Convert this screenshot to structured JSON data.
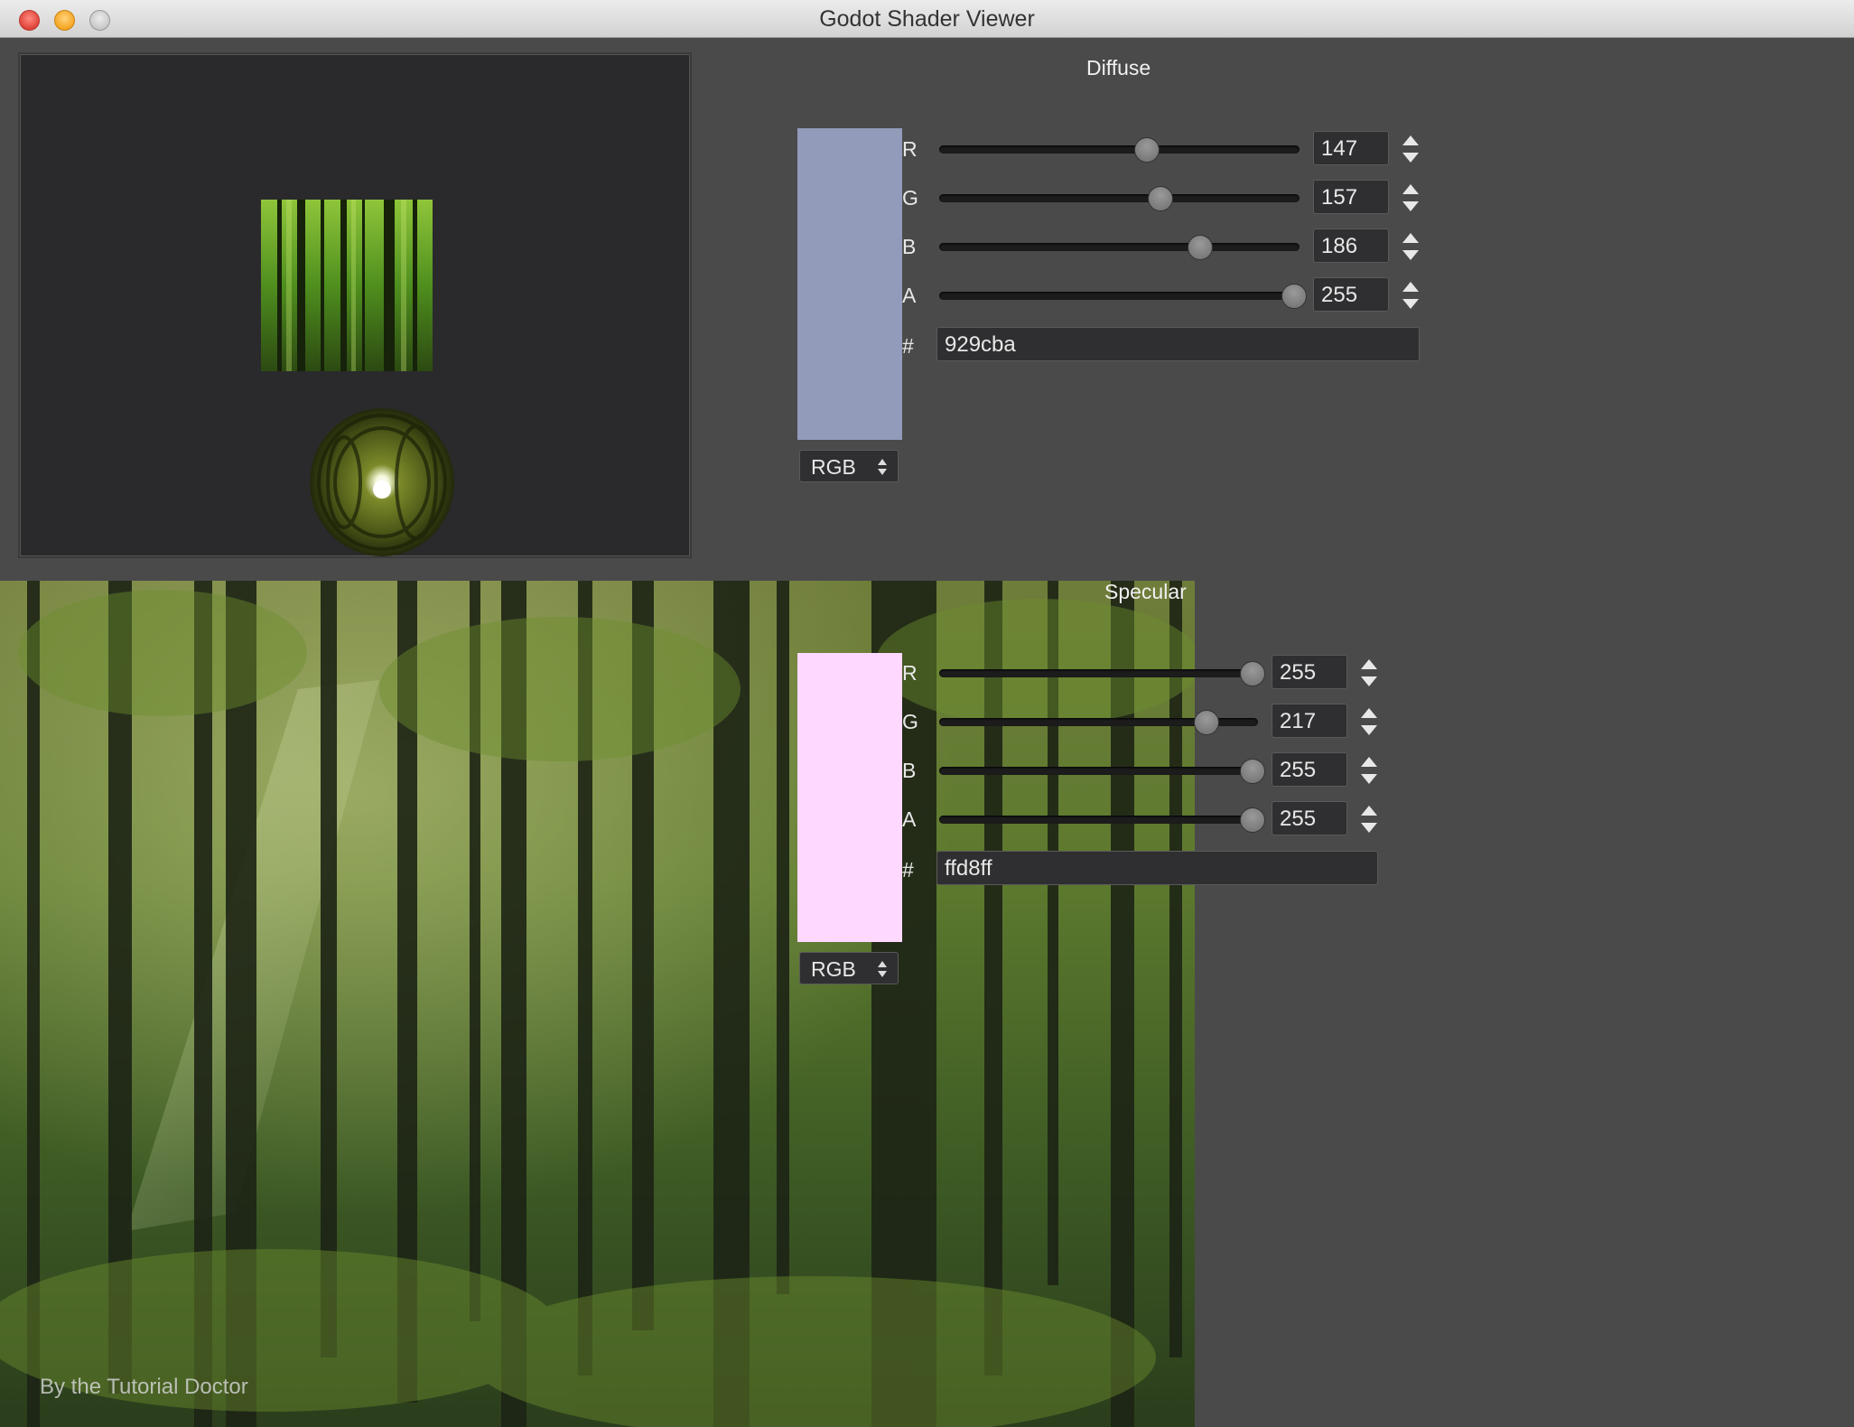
{
  "window": {
    "title": "Godot Shader Viewer"
  },
  "credit": "By the Tutorial Doctor",
  "diffuse": {
    "title": "Diffuse",
    "color": "#929cba",
    "mode": "RGB",
    "hex_label": "#",
    "hex": "929cba",
    "channels": [
      {
        "label": "R",
        "value": "147",
        "fraction": 0.576
      },
      {
        "label": "G",
        "value": "157",
        "fraction": 0.616
      },
      {
        "label": "B",
        "value": "186",
        "fraction": 0.729
      },
      {
        "label": "A",
        "value": "255",
        "fraction": 1.0
      }
    ]
  },
  "specular": {
    "title": "Specular",
    "color": "#ffd8ff",
    "mode": "RGB",
    "hex_label": "#",
    "hex": "ffd8ff",
    "channels": [
      {
        "label": "R",
        "value": "255",
        "fraction": 1.0
      },
      {
        "label": "G",
        "value": "217",
        "fraction": 0.851
      },
      {
        "label": "B",
        "value": "255",
        "fraction": 1.0
      },
      {
        "label": "A",
        "value": "255",
        "fraction": 1.0
      }
    ]
  }
}
